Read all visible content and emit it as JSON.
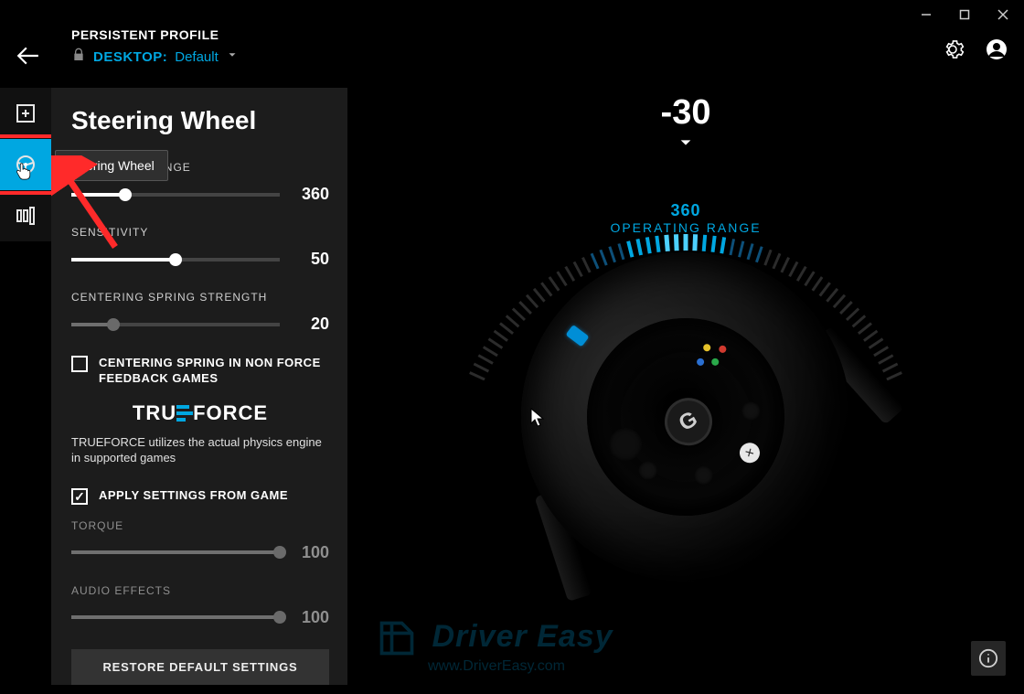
{
  "window": {
    "title_minimize": "−",
    "title_maximize": "▢",
    "title_close": "×"
  },
  "header": {
    "title": "PERSISTENT PROFILE",
    "desktop_label": "DESKTOP:",
    "profile_name": "Default"
  },
  "rail": {
    "tooltip": "Steering Wheel"
  },
  "panel": {
    "title": "Steering Wheel",
    "operating_range": {
      "label": "OPERATING RANGE",
      "value": "360",
      "fill_pct": 26
    },
    "sensitivity": {
      "label": "SENSITIVITY",
      "value": "50",
      "fill_pct": 50
    },
    "centering": {
      "label": "CENTERING SPRING STRENGTH",
      "value": "20",
      "fill_pct": 20
    },
    "spring_nonffb": {
      "label": "CENTERING SPRING IN NON FORCE FEEDBACK GAMES",
      "checked": false
    },
    "trueforce_logo": {
      "pre": "TRU",
      "post": "FORCE"
    },
    "trueforce_desc": "TRUEFORCE utilizes the actual physics engine in supported games",
    "apply_from_game": {
      "label": "APPLY SETTINGS FROM GAME",
      "checked": true
    },
    "torque": {
      "label": "TORQUE",
      "value": "100",
      "fill_pct": 100
    },
    "audio": {
      "label": "AUDIO EFFECTS",
      "value": "100",
      "fill_pct": 100
    },
    "restore": "RESTORE DEFAULT SETTINGS"
  },
  "main": {
    "angle": "-30",
    "range_num": "360",
    "range_txt": "OPERATING RANGE"
  },
  "watermark": {
    "brand": "Driver Easy",
    "url": "www.DriverEasy.com"
  }
}
